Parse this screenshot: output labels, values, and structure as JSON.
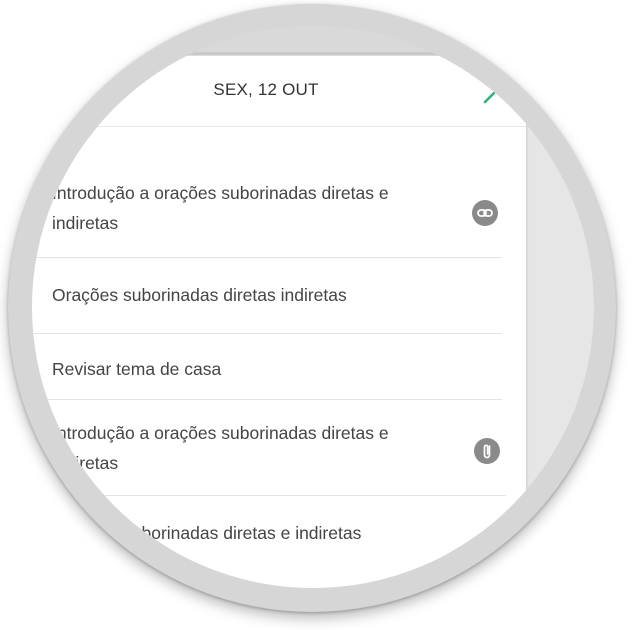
{
  "day_header": {
    "title": "SEX, 12 OUT",
    "next_icon": "chevron-right-icon",
    "accent_color": "#2db37a"
  },
  "items": [
    {
      "label": "Introdução a orações suborinadas diretas e indiretas",
      "icon": "link-icon"
    },
    {
      "label": "Orações suborinadas diretas  indiretas",
      "icon": ""
    },
    {
      "label": "Revisar tema de casa",
      "icon": ""
    },
    {
      "label": "Introdução a orações suborinadas diretas e indiretas",
      "icon": "paperclip-icon"
    },
    {
      "label": "Orações suborinadas diretas e indiretas",
      "icon": ""
    }
  ]
}
